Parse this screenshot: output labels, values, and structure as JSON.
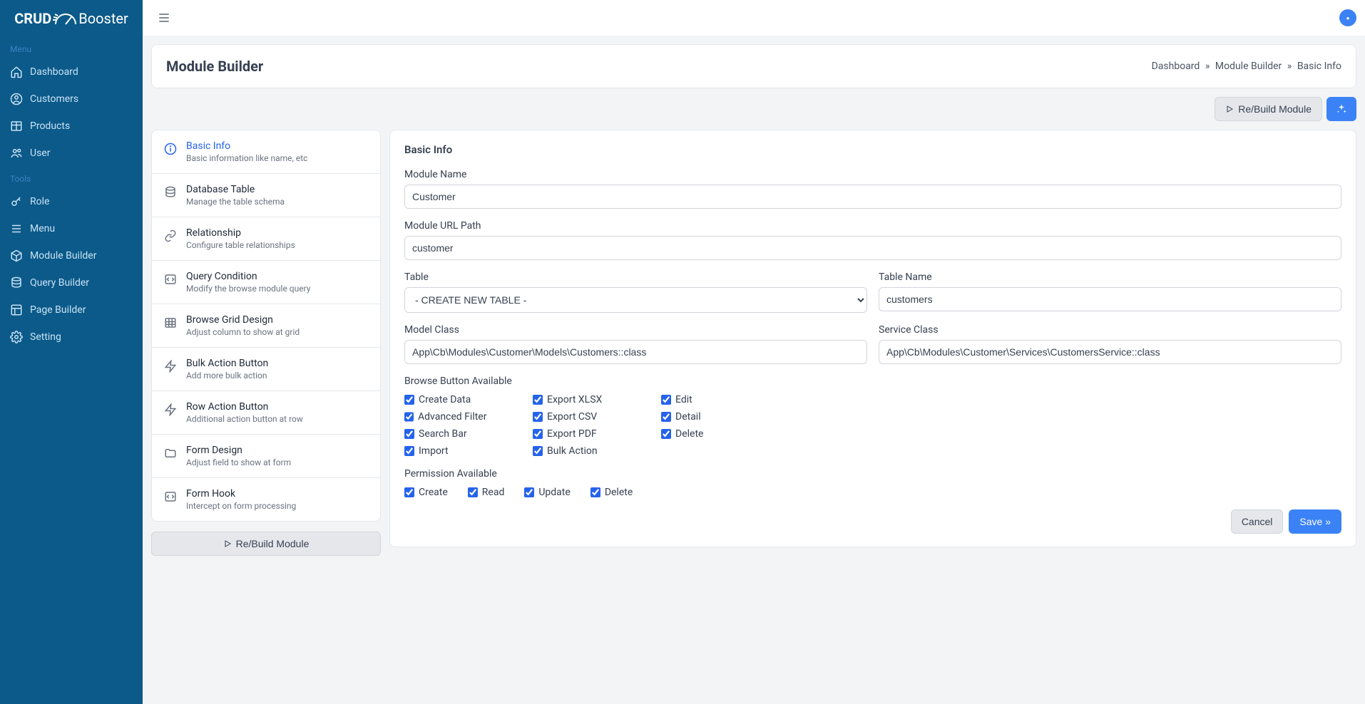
{
  "logo": {
    "bold": "CRUD",
    "light": "Booster"
  },
  "sidebar": {
    "menu_label": "Menu",
    "tools_label": "Tools",
    "menu_items": [
      {
        "label": "Dashboard",
        "icon": "home"
      },
      {
        "label": "Customers",
        "icon": "user-circle"
      },
      {
        "label": "Products",
        "icon": "table"
      },
      {
        "label": "User",
        "icon": "users"
      }
    ],
    "tools_items": [
      {
        "label": "Role",
        "icon": "key"
      },
      {
        "label": "Menu",
        "icon": "list"
      },
      {
        "label": "Module Builder",
        "icon": "cube"
      },
      {
        "label": "Query Builder",
        "icon": "database"
      },
      {
        "label": "Page Builder",
        "icon": "layout"
      },
      {
        "label": "Setting",
        "icon": "gear"
      }
    ]
  },
  "header": {
    "title": "Module Builder",
    "breadcrumb": [
      "Dashboard",
      "Module Builder",
      "Basic Info"
    ]
  },
  "actions": {
    "rebuild": "Re/Build Module"
  },
  "steps": [
    {
      "title": "Basic Info",
      "desc": "Basic information like name, etc",
      "icon": "info",
      "active": true
    },
    {
      "title": "Database Table",
      "desc": "Manage the table schema",
      "icon": "database"
    },
    {
      "title": "Relationship",
      "desc": "Configure table relationships",
      "icon": "link"
    },
    {
      "title": "Query Condition",
      "desc": "Modify the browse module query",
      "icon": "code"
    },
    {
      "title": "Browse Grid Design",
      "desc": "Adjust column to show at grid",
      "icon": "grid"
    },
    {
      "title": "Bulk Action Button",
      "desc": "Add more bulk action",
      "icon": "bolt"
    },
    {
      "title": "Row Action Button",
      "desc": "Additional action button at row",
      "icon": "bolt"
    },
    {
      "title": "Form Design",
      "desc": "Adjust field to show at form",
      "icon": "folder"
    },
    {
      "title": "Form Hook",
      "desc": "Intercept on form processing",
      "icon": "code"
    }
  ],
  "rebuild_below": "Re/Build Module",
  "form": {
    "title": "Basic Info",
    "module_name_label": "Module Name",
    "module_name": "Customer",
    "url_path_label": "Module URL Path",
    "url_path": "customer",
    "table_label": "Table",
    "table_select": "- CREATE NEW TABLE -",
    "table_name_label": "Table Name",
    "table_name": "customers",
    "model_class_label": "Model Class",
    "model_class": "App\\Cb\\Modules\\Customer\\Models\\Customers::class",
    "service_class_label": "Service Class",
    "service_class": "App\\Cb\\Modules\\Customer\\Services\\CustomersService::class",
    "browse_label": "Browse Button Available",
    "browse_checks_col1": [
      "Create Data",
      "Advanced Filter",
      "Search Bar",
      "Import"
    ],
    "browse_checks_col2": [
      "Export XLSX",
      "Export CSV",
      "Export PDF",
      "Bulk Action"
    ],
    "browse_checks_col3": [
      "Edit",
      "Detail",
      "Delete"
    ],
    "perm_label": "Permission Available",
    "perm_checks": [
      "Create",
      "Read",
      "Update",
      "Delete"
    ],
    "cancel": "Cancel",
    "save": "Save »"
  }
}
